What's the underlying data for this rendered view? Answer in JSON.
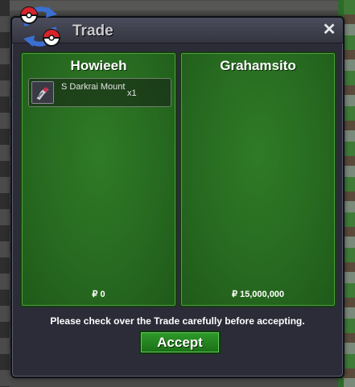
{
  "window": {
    "title": "Trade",
    "close_glyph": "✕",
    "logo_icon": "trade-swap-icon"
  },
  "left_panel": {
    "player_name": "Howieeh",
    "items": [
      {
        "name": "S Darkrai Mount",
        "quantity": "x1",
        "icon": "darkrai-mount-icon"
      }
    ],
    "money": "₽ 0"
  },
  "right_panel": {
    "player_name": "Grahamsito",
    "items": [],
    "money": "₽ 15,000,000"
  },
  "notice": "Please check over the Trade carefully before accepting.",
  "accept_label": "Accept",
  "colors": {
    "panel_green": "#276a20",
    "button_green": "#1a6e16",
    "window_bg": "#2b2c38"
  }
}
